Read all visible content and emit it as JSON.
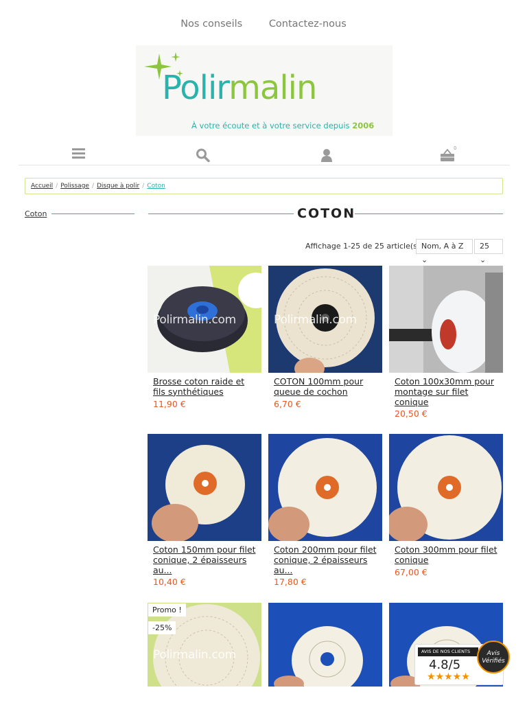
{
  "topnav": {
    "link1": "Nos conseils",
    "link2": "Contactez-nous"
  },
  "logo": {
    "part1": "Polir",
    "part2": "malin",
    "tagline_prefix": "À votre écoute et à votre service depuis",
    "tagline_year": "2006"
  },
  "iconbar": {
    "icons": [
      "menu-icon",
      "search-icon",
      "user-icon",
      "cart-icon"
    ],
    "cart_count": "0"
  },
  "breadcrumb": [
    "Accueil",
    "Polissage",
    "Disque à polir",
    "Coton"
  ],
  "sidebar": {
    "category": "Coton"
  },
  "page": {
    "title": "COTON"
  },
  "listing": {
    "showing": "Affichage 1-25 de 25 article(s)",
    "sort": "Nom, A à Z",
    "per_page": "25"
  },
  "watermark": "Polirmalin.com",
  "products": [
    {
      "name": "Brosse coton raide et fils synthétiques",
      "price": "11,90 €"
    },
    {
      "name": "COTON 100mm pour queue de cochon",
      "price": "6,70 €"
    },
    {
      "name": "Coton 100x30mm pour montage sur filet conique",
      "price": "20,50 €"
    },
    {
      "name": "Coton 150mm pour filet conique, 2 épaisseurs au...",
      "price": "10,40 €"
    },
    {
      "name": "Coton 200mm pour filet conique, 2 épaisseurs au...",
      "price": "17,80 €"
    },
    {
      "name": "Coton 300mm pour filet conique",
      "price": "67,00 €"
    }
  ],
  "badges": {
    "promo": "Promo !",
    "discount": "-25%"
  },
  "reviews": {
    "header": "AVIS DE NOS CLIENTS",
    "rating": "4.8/5",
    "stars": "★★★★★",
    "seal": "Avis Vérifiés"
  },
  "colors": {
    "teal": "#2bb3ab",
    "green": "#8cc63f",
    "price": "#e8571f",
    "star": "#f29100"
  }
}
